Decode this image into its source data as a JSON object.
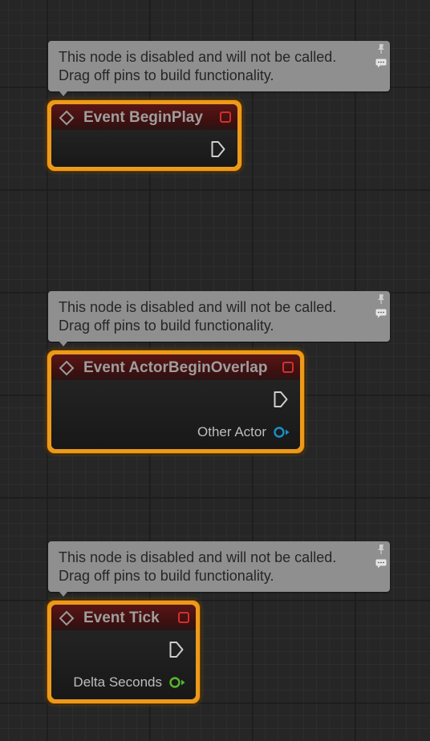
{
  "nodes": [
    {
      "comment": "This node is disabled and will not be called.\nDrag off pins to build functionality.",
      "title": "Event BeginPlay",
      "output_pin": null
    },
    {
      "comment": "This node is disabled and will not be called.\nDrag off pins to build functionality.",
      "title": "Event ActorBeginOverlap",
      "output_pin": {
        "label": "Other Actor",
        "color": "#1a8fc7"
      }
    },
    {
      "comment": "This node is disabled and will not be called.\nDrag off pins to build functionality.",
      "title": "Event Tick",
      "output_pin": {
        "label": "Delta Seconds",
        "color": "#58b82a"
      }
    }
  ],
  "colors": {
    "node_border": "#ec9a1b",
    "header": "#5a1616",
    "comment_bg": "#8f8f8f",
    "graph_bg": "#262626"
  },
  "icons": {
    "comment_pin": "pin-icon",
    "comment_bubble": "comment-bubble-icon",
    "event": "event-diamond-icon",
    "delegate": "delegate-output-icon",
    "exec": "exec-output-pin"
  }
}
